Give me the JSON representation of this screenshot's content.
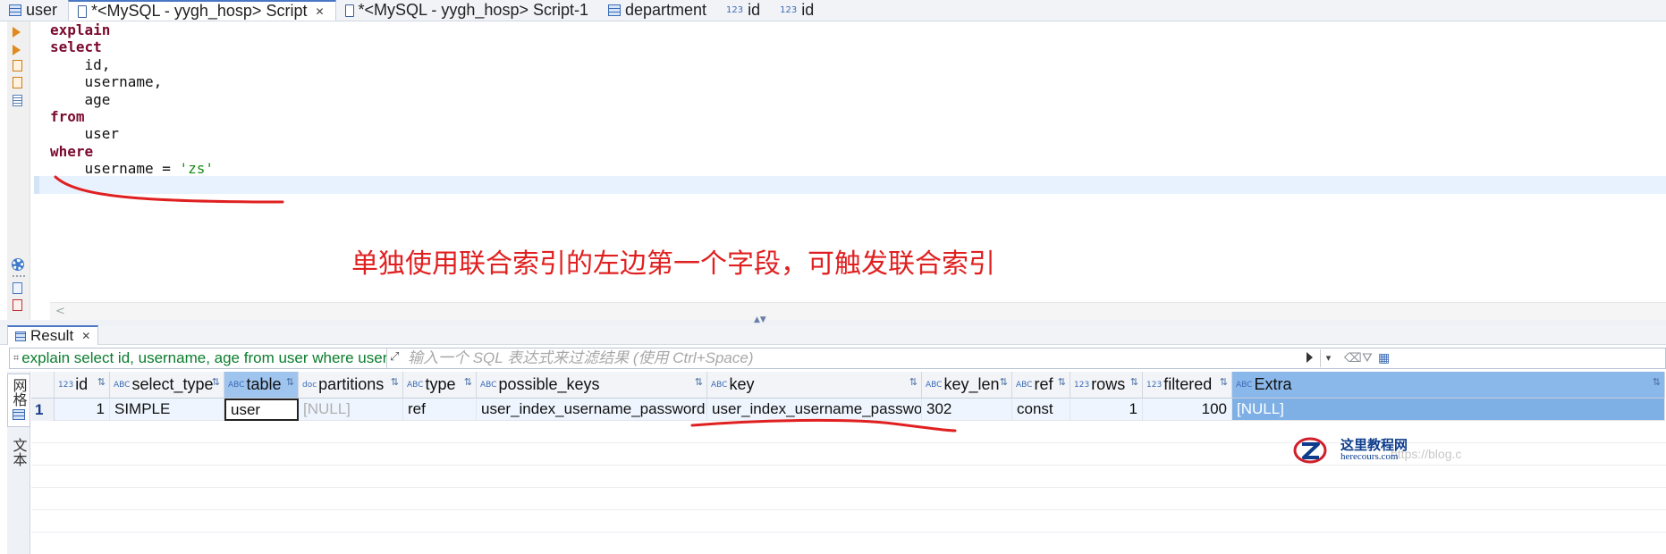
{
  "tabs": [
    {
      "label": "user",
      "icon": "table-icon",
      "active": false
    },
    {
      "label": "*<MySQL - yygh_hosp> Script",
      "icon": "script-icon",
      "active": true,
      "closable": true
    },
    {
      "label": "*<MySQL - yygh_hosp> Script-1",
      "icon": "script-icon",
      "active": false
    },
    {
      "label": "department",
      "icon": "table-icon",
      "active": false
    },
    {
      "label": "id",
      "icon": "numeric-column-icon",
      "badge": "123",
      "active": false
    },
    {
      "label": "id",
      "icon": "numeric-column-icon",
      "badge": "123",
      "active": false
    }
  ],
  "editor": {
    "lines": [
      [
        {
          "t": "explain",
          "k": "kw"
        }
      ],
      [
        {
          "t": "select",
          "k": "kw"
        }
      ],
      [
        {
          "t": "    id,",
          "k": ""
        }
      ],
      [
        {
          "t": "    username,",
          "k": ""
        }
      ],
      [
        {
          "t": "    age",
          "k": ""
        }
      ],
      [
        {
          "t": "from",
          "k": "kw"
        }
      ],
      [
        {
          "t": "    user",
          "k": ""
        }
      ],
      [
        {
          "t": "where",
          "k": "kw"
        }
      ],
      [
        {
          "t": "    username = ",
          "k": ""
        },
        {
          "t": "'zs'",
          "k": "str"
        }
      ]
    ],
    "annotation": "单独使用联合索引的左边第一个字段，可触发联合索引",
    "annotation_color": "#e02020"
  },
  "result": {
    "tab_label": "Result",
    "close_glyph": "✕",
    "filter_sql": "explain select id, username, age from user where userna",
    "filter_placeholder": "输入一个 SQL 表达式来过滤结果 (使用 Ctrl+Space)",
    "side_tabs": [
      {
        "label": "网格",
        "icon": "grid-icon",
        "active": true
      },
      {
        "label": "文本",
        "icon": "text-icon",
        "active": false
      }
    ],
    "columns": [
      {
        "name": "id",
        "badge": "123"
      },
      {
        "name": "select_type",
        "badge": "ABC"
      },
      {
        "name": "table",
        "badge": "ABC",
        "selected": true
      },
      {
        "name": "partitions",
        "badge": "doc"
      },
      {
        "name": "type",
        "badge": "ABC"
      },
      {
        "name": "possible_keys",
        "badge": "ABC"
      },
      {
        "name": "key",
        "badge": "ABC"
      },
      {
        "name": "key_len",
        "badge": "ABC"
      },
      {
        "name": "ref",
        "badge": "ABC"
      },
      {
        "name": "rows",
        "badge": "123"
      },
      {
        "name": "filtered",
        "badge": "123"
      },
      {
        "name": "Extra",
        "badge": "ABC",
        "highlighted": true
      }
    ],
    "rows": [
      {
        "num": "1",
        "cells": [
          "1",
          "SIMPLE",
          "user",
          "[NULL]",
          "ref",
          "user_index_username_password",
          "user_index_username_password",
          "302",
          "const",
          "1",
          "100",
          "[NULL]"
        ]
      }
    ]
  },
  "watermark": {
    "url": "https://blog.c",
    "site_name": "这里教程网",
    "domain": "herecours.com"
  },
  "colors": {
    "keyword": "#7a0a2d",
    "string": "#1a8a1a",
    "annotation_stroke": "#e02020",
    "accent": "#4a78c2"
  }
}
